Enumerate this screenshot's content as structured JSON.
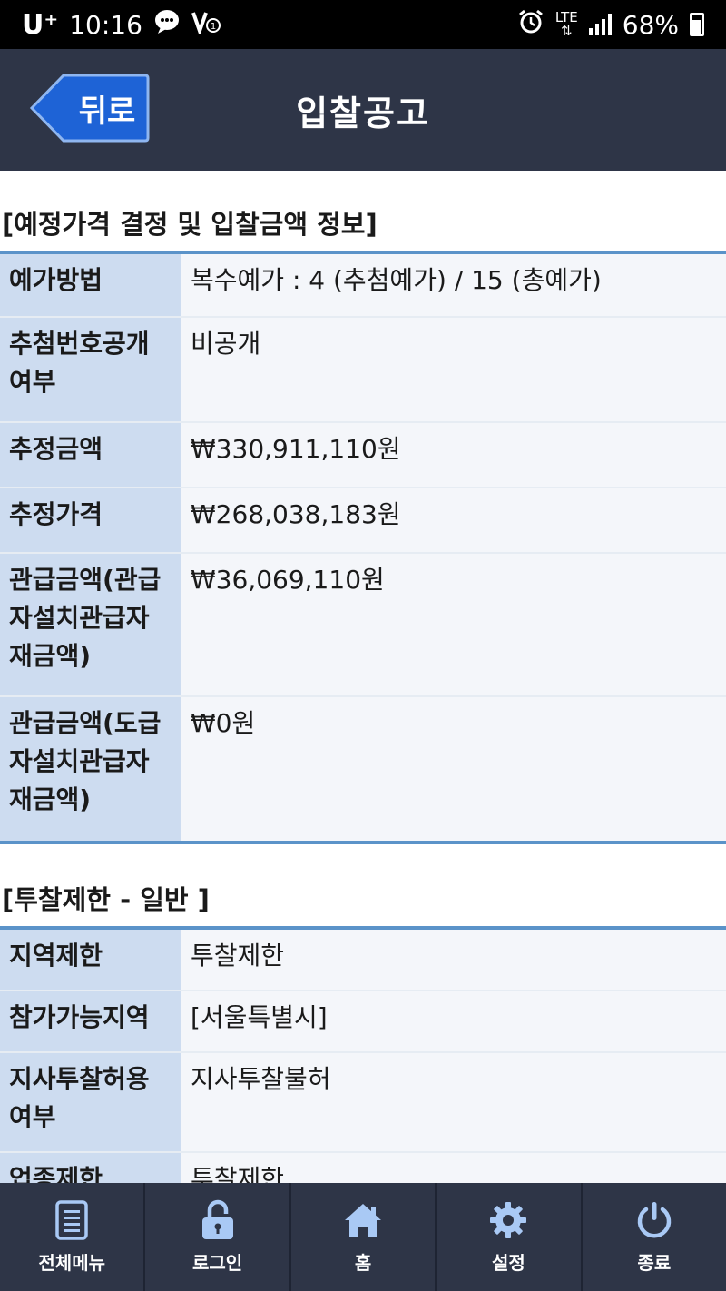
{
  "status_bar": {
    "carrier": "U⁺",
    "time": "10:16",
    "lte": "LTE",
    "battery": "68%"
  },
  "header": {
    "back_label": "뒤로",
    "title": "입찰공고"
  },
  "section1": {
    "title": "[예정가격 결정 및 입찰금액 정보]",
    "rows": [
      {
        "label": "예가방법",
        "value": "복수예가 : 4 (추첨예가) / 15 (총예가)"
      },
      {
        "label": "추첨번호공개여부",
        "value": "비공개"
      },
      {
        "label": "추정금액",
        "value": "₩330,911,110원"
      },
      {
        "label": "추정가격",
        "value": "₩268,038,183원"
      },
      {
        "label": "관급금액(관급자설치관급자재금액)",
        "value": "₩36,069,110원"
      },
      {
        "label": "관급금액(도급자설치관급자재금액)",
        "value": "₩0원"
      }
    ]
  },
  "section2": {
    "title": "[투찰제한 - 일반 ]",
    "rows": [
      {
        "label": "지역제한",
        "value": "투찰제한"
      },
      {
        "label": "참가가능지역",
        "value": "[서울특별시]"
      },
      {
        "label": "지사투찰허용여부",
        "value": "지사투찰불허"
      },
      {
        "label": "업종제한",
        "value": "투찰제한"
      }
    ]
  },
  "bottom_nav": [
    {
      "label": "전체메뉴",
      "icon": "document-list-icon"
    },
    {
      "label": "로그인",
      "icon": "lock-icon"
    },
    {
      "label": "홈",
      "icon": "home-icon"
    },
    {
      "label": "설정",
      "icon": "gear-icon"
    },
    {
      "label": "종료",
      "icon": "power-icon"
    }
  ],
  "colors": {
    "header_bg": "#2e3547",
    "back_button": "#1e63d6",
    "label_bg": "#cddcf0",
    "value_bg": "#f4f6fa",
    "table_border": "#5b93c9"
  }
}
